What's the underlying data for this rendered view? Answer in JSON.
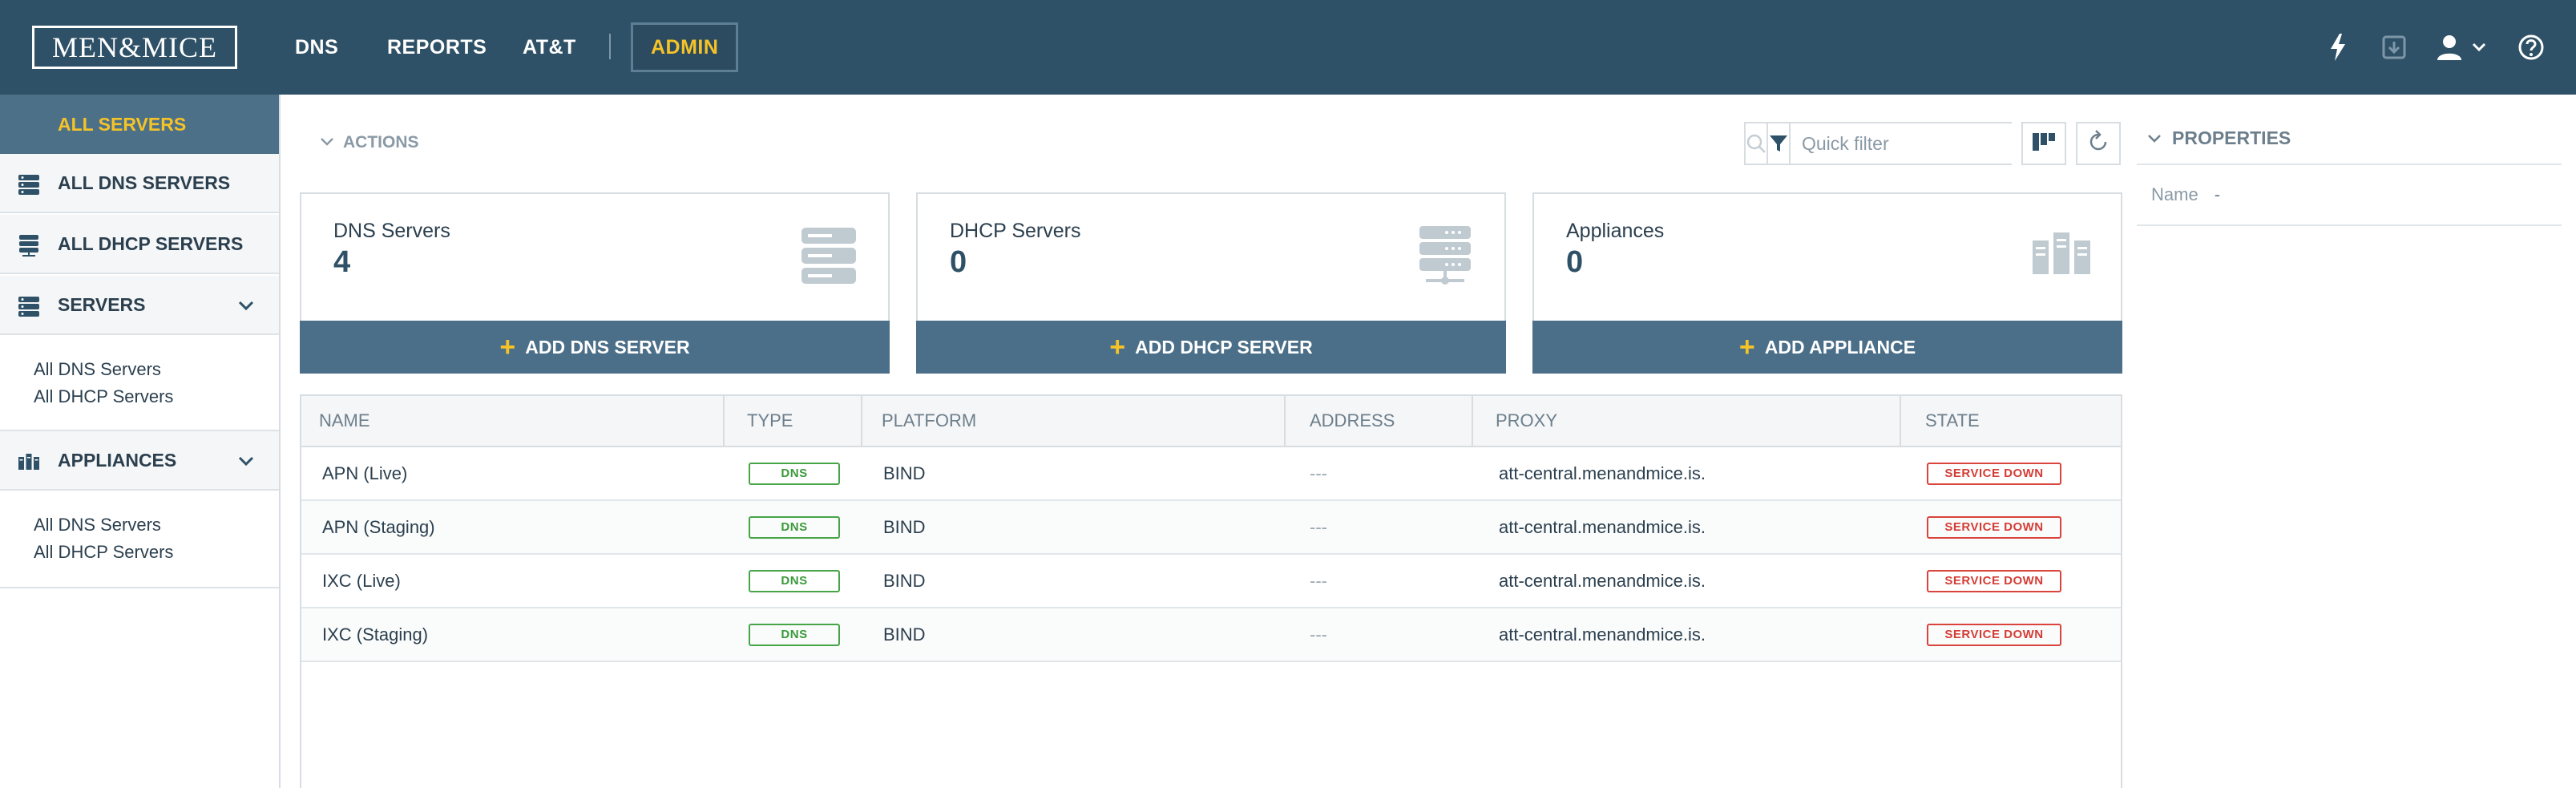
{
  "app": {
    "logo_text": "MEN&MICE"
  },
  "topnav": {
    "items": [
      {
        "label": "DNS"
      },
      {
        "label": "REPORTS"
      },
      {
        "label": "AT&T"
      },
      {
        "label": "ADMIN"
      }
    ],
    "icons": [
      "lightning-icon",
      "package-icon",
      "user-icon",
      "chevron-down-icon",
      "help-icon"
    ],
    "accent_color": "#f5c327",
    "bar_color": "#2f5167"
  },
  "sidebar": {
    "all_servers": "ALL SERVERS",
    "items": [
      {
        "label": "ALL DNS SERVERS",
        "icon": "server-stack-icon"
      },
      {
        "label": "ALL DHCP SERVERS",
        "icon": "dhcp-server-icon"
      },
      {
        "label": "SERVERS",
        "icon": "server-stack-icon",
        "subitems": [
          "All DNS Servers",
          "All DHCP Servers"
        ]
      },
      {
        "label": "APPLIANCES",
        "icon": "appliance-icon",
        "subitems": [
          "All DNS Servers",
          "All DHCP Servers"
        ]
      }
    ]
  },
  "toolbar": {
    "actions_label": "ACTIONS",
    "quick_filter_placeholder": "Quick filter",
    "quick_filter_value": ""
  },
  "cards": [
    {
      "title": "DNS Servers",
      "count": "4",
      "button": "ADD DNS SERVER",
      "icon": "server-stack-icon"
    },
    {
      "title": "DHCP Servers",
      "count": "0",
      "button": "ADD DHCP SERVER",
      "icon": "dhcp-server-icon"
    },
    {
      "title": "Appliances",
      "count": "0",
      "button": "ADD APPLIANCE",
      "icon": "appliance-icon"
    }
  ],
  "table": {
    "columns": [
      "NAME",
      "TYPE",
      "PLATFORM",
      "ADDRESS",
      "PROXY",
      "STATE"
    ],
    "rows": [
      {
        "name": "APN (Live)",
        "type": "DNS",
        "platform": "BIND",
        "address": "---",
        "proxy": "att-central.menandmice.is.",
        "state": "SERVICE DOWN"
      },
      {
        "name": "APN (Staging)",
        "type": "DNS",
        "platform": "BIND",
        "address": "---",
        "proxy": "att-central.menandmice.is.",
        "state": "SERVICE DOWN"
      },
      {
        "name": "IXC (Live)",
        "type": "DNS",
        "platform": "BIND",
        "address": "---",
        "proxy": "att-central.menandmice.is.",
        "state": "SERVICE DOWN"
      },
      {
        "name": "IXC (Staging)",
        "type": "DNS",
        "platform": "BIND",
        "address": "---",
        "proxy": "att-central.menandmice.is.",
        "state": "SERVICE DOWN"
      }
    ],
    "type_badge_color": "#47a547",
    "state_badge_color": "#d9443d"
  },
  "properties": {
    "title": "PROPERTIES",
    "rows": [
      {
        "label": "Name",
        "value": "-"
      }
    ]
  }
}
